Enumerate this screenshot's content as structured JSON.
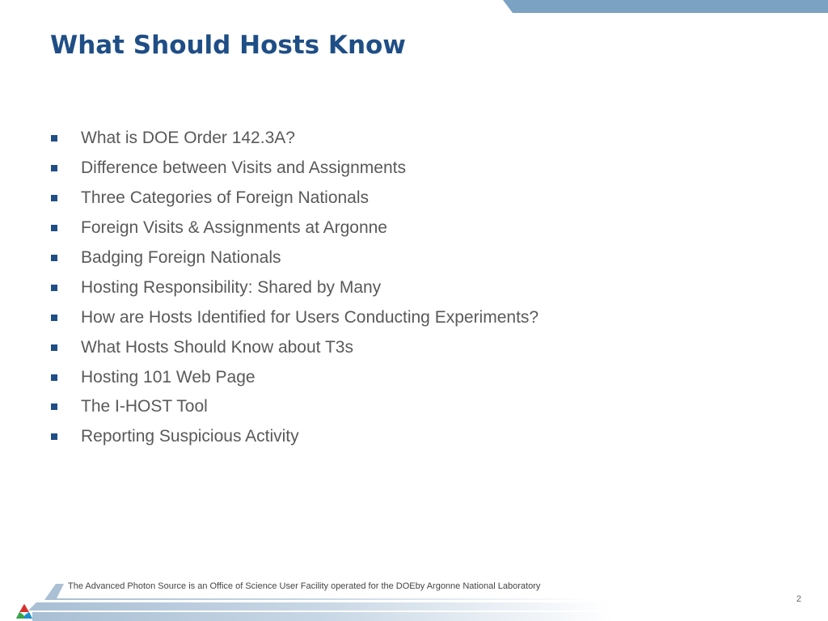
{
  "slide": {
    "title": "What Should Hosts Know",
    "bullets": [
      "What is DOE Order 142.3A?",
      "Difference between Visits and Assignments",
      "Three Categories of Foreign Nationals",
      "Foreign Visits & Assignments at Argonne",
      "Badging Foreign Nationals",
      "Hosting Responsibility: Shared by Many",
      "How are Hosts Identified for Users Conducting Experiments?",
      "What Hosts Should Know about T3s",
      "Hosting 101 Web Page",
      "The I-HOST Tool",
      "Reporting Suspicious Activity"
    ],
    "footer_text": "The Advanced Photon Source is an Office of Science User Facility operated for the DOEby Argonne National Laboratory",
    "page_number": "2",
    "logo_icon": "argonne-triangle-logo-icon"
  },
  "colors": {
    "title": "#1f4e86",
    "bullet": "#1f4e86",
    "body_text": "#595959",
    "top_band": "#7ba1c3"
  }
}
